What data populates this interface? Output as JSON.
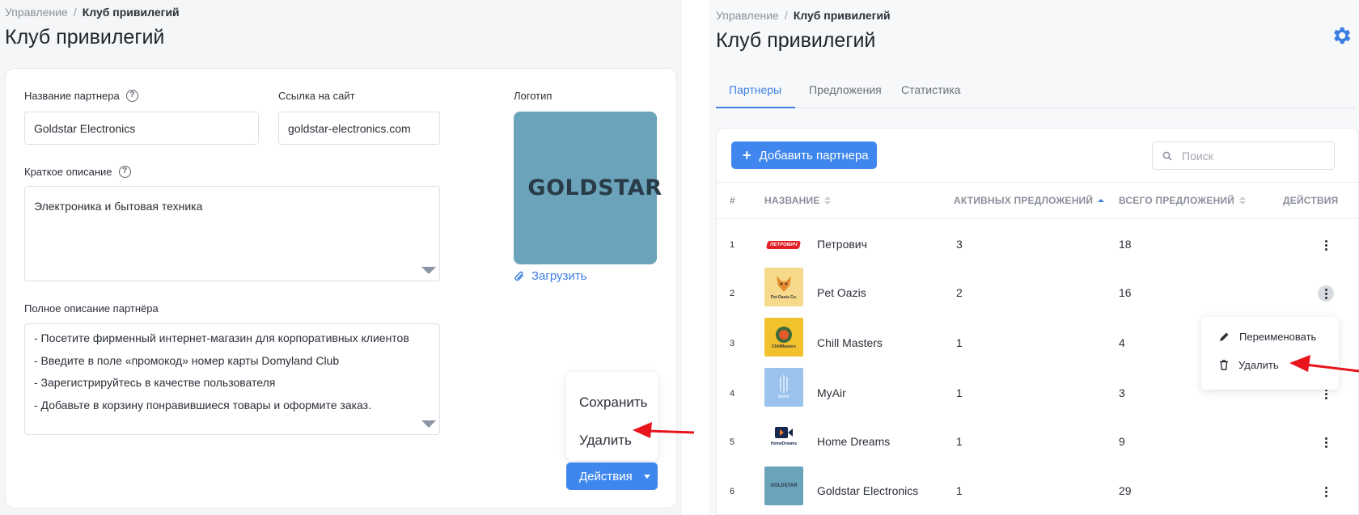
{
  "left_panel": {
    "breadcrumb": {
      "parent": "Управление",
      "separator": "/",
      "current": "Клуб привилегий"
    },
    "title": "Клуб привилегий",
    "form": {
      "partner_name": {
        "label": "Название партнера",
        "value": "Goldstar Electronics"
      },
      "site_link": {
        "label": "Ссылка на сайт",
        "value": "goldstar-electronics.com"
      },
      "logo": {
        "label": "Логотип",
        "brand_text": "GOLDSTAR",
        "upload_label": "Загрузить"
      },
      "short_desc": {
        "label": "Краткое описание",
        "value": "Электроника и бытовая техника"
      },
      "full_desc": {
        "label": "Полное описание партнёра",
        "lines": [
          "- Посетите фирменный интернет-магазин для корпоративных клиентов",
          "- Введите в поле «промокод» номер карты Domyland Club",
          "- Зарегистрируйтесь в качестве пользователя",
          "- Добавьте в корзину понравившиеся товары и оформите заказ."
        ]
      }
    },
    "actions_menu": {
      "save": "Сохранить",
      "delete": "Удалить"
    },
    "actions_button": "Действия"
  },
  "right_panel": {
    "breadcrumb": {
      "parent": "Управление",
      "separator": "/",
      "current": "Клуб привилегий"
    },
    "title": "Клуб привилегий",
    "tabs": [
      {
        "label": "Партнеры",
        "active": true
      },
      {
        "label": "Предложения",
        "active": false
      },
      {
        "label": "Статистика",
        "active": false
      }
    ],
    "add_button": "Добавить партнера",
    "search_placeholder": "Поиск",
    "table": {
      "headers": [
        "#",
        "НАЗВАНИЕ",
        "АКТИВНЫХ ПРЕДЛОЖЕНИЙ",
        "ВСЕГО ПРЕДЛОЖЕНИЙ",
        "ДЕЙСТВИЯ"
      ],
      "rows": [
        {
          "num": "1",
          "name": "Петрович",
          "active": "3",
          "total": "18",
          "logo_text": "ПЕТРОВИЧ"
        },
        {
          "num": "2",
          "name": "Pet Oazis",
          "active": "2",
          "total": "16",
          "logo_text": "Pet Oasis Co."
        },
        {
          "num": "3",
          "name": "Chill Masters",
          "active": "1",
          "total": "4",
          "logo_text": "ChillMasters"
        },
        {
          "num": "4",
          "name": "MyAir",
          "active": "1",
          "total": "3",
          "logo_text": "MyAir"
        },
        {
          "num": "5",
          "name": "Home Dreams",
          "active": "1",
          "total": "9",
          "logo_text": "HomeDreams"
        },
        {
          "num": "6",
          "name": "Goldstar Electronics",
          "active": "1",
          "total": "29",
          "logo_text": "GOLDSTAR"
        }
      ]
    },
    "row_menu": {
      "rename": "Переименовать",
      "delete": "Удалить"
    }
  },
  "colors": {
    "accent": "#3f87ee",
    "link": "#3d7fe0",
    "arrow": "#e8141c"
  }
}
